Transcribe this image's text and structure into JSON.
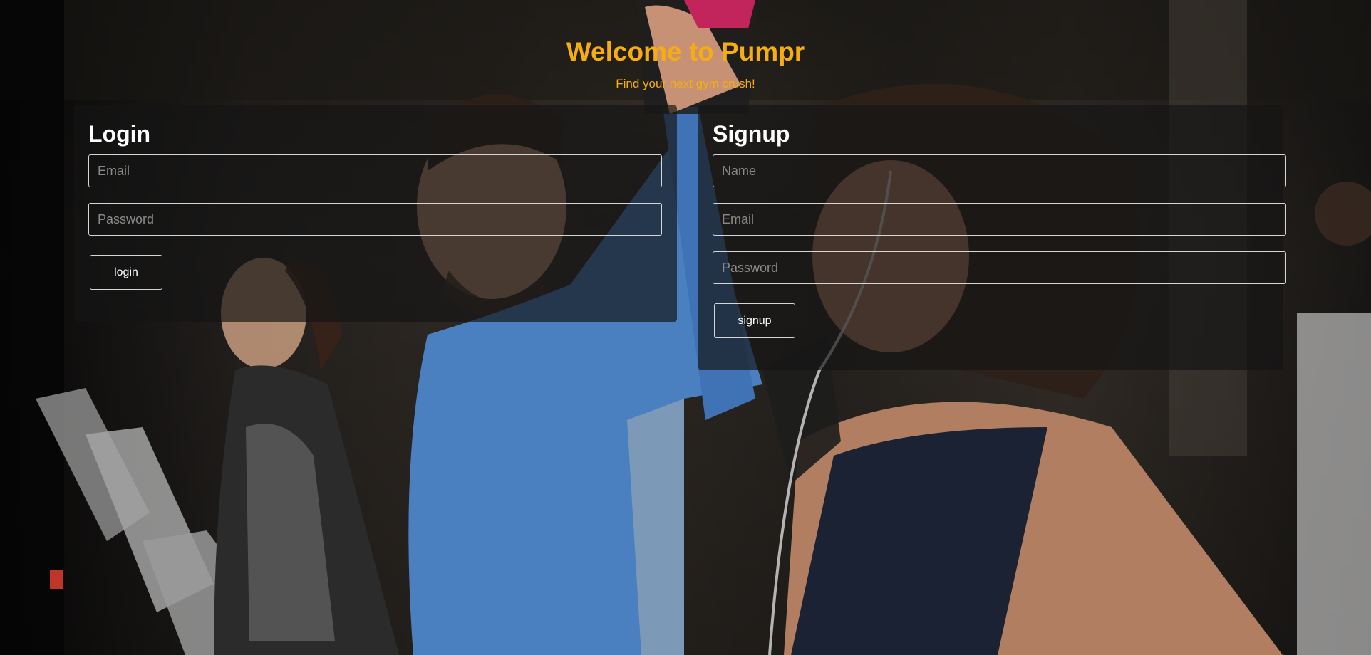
{
  "header": {
    "title": "Welcome to Pumpr",
    "subtitle": "Find your next gym crush!"
  },
  "login": {
    "heading": "Login",
    "email_placeholder": "Email",
    "password_placeholder": "Password",
    "button_label": "login"
  },
  "signup": {
    "heading": "Signup",
    "name_placeholder": "Name",
    "email_placeholder": "Email",
    "password_placeholder": "Password",
    "button_label": "signup"
  },
  "colors": {
    "accent": "#f6ad12",
    "panel_bg": "rgba(20,20,20,0.68)",
    "text": "#ffffff",
    "field_border": "#d6d6d6"
  }
}
